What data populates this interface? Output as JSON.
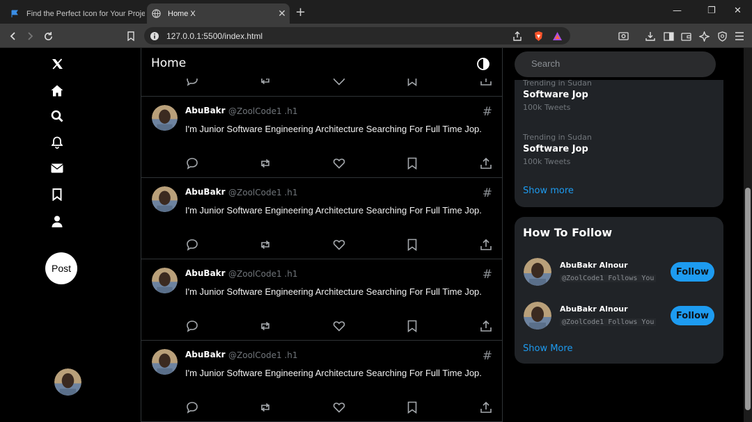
{
  "browser": {
    "tabs": [
      {
        "title": "Find the Perfect Icon for Your Project",
        "active": false
      },
      {
        "title": "Home X",
        "active": true
      }
    ],
    "url": "127.0.0.1:5500/index.html"
  },
  "sidebar": {
    "nav": [
      "x-logo-icon",
      "home-icon",
      "search-icon",
      "bell-icon",
      "envelope-icon",
      "bookmark-icon",
      "user-icon"
    ],
    "post_label": "Post"
  },
  "feed": {
    "title": "Home",
    "tweets": [
      {
        "name": "AbuBakr",
        "handle": "@ZoolCode1 .h1",
        "text": "I'm Junior Software Engineering Architecture Searching For Full Time Jop."
      },
      {
        "name": "AbuBakr",
        "handle": "@ZoolCode1 .h1",
        "text": "I'm Junior Software Engineering Architecture Searching For Full Time Jop."
      },
      {
        "name": "AbuBakr",
        "handle": "@ZoolCode1 .h1",
        "text": "I'm Junior Software Engineering Architecture Searching For Full Time Jop."
      },
      {
        "name": "AbuBakr",
        "handle": "@ZoolCode1 .h1",
        "text": "I'm Junior Software Engineering Architecture Searching For Full Time Jop."
      }
    ],
    "hash_symbol": "#"
  },
  "search": {
    "placeholder": "Search"
  },
  "trends": {
    "items": [
      {
        "category": "Trending in Sudan",
        "topic": "Software Jop",
        "count": "100k Tweets"
      },
      {
        "category": "Trending in Sudan",
        "topic": "Software Jop",
        "count": "100k Tweets"
      }
    ],
    "show_more": "Show more"
  },
  "who_to_follow": {
    "title": "How To Follow",
    "items": [
      {
        "name": "AbuBakr Alnour",
        "handle": "@ZoolCode1 Follows You",
        "button": "Follow"
      },
      {
        "name": "AbuBakr Alnour",
        "handle": "@ZoolCode1 Follows You",
        "button": "Follow"
      }
    ],
    "show_more": "Show More"
  },
  "colors": {
    "accent": "#1d9bf0",
    "background": "#000000",
    "card": "#202327"
  }
}
